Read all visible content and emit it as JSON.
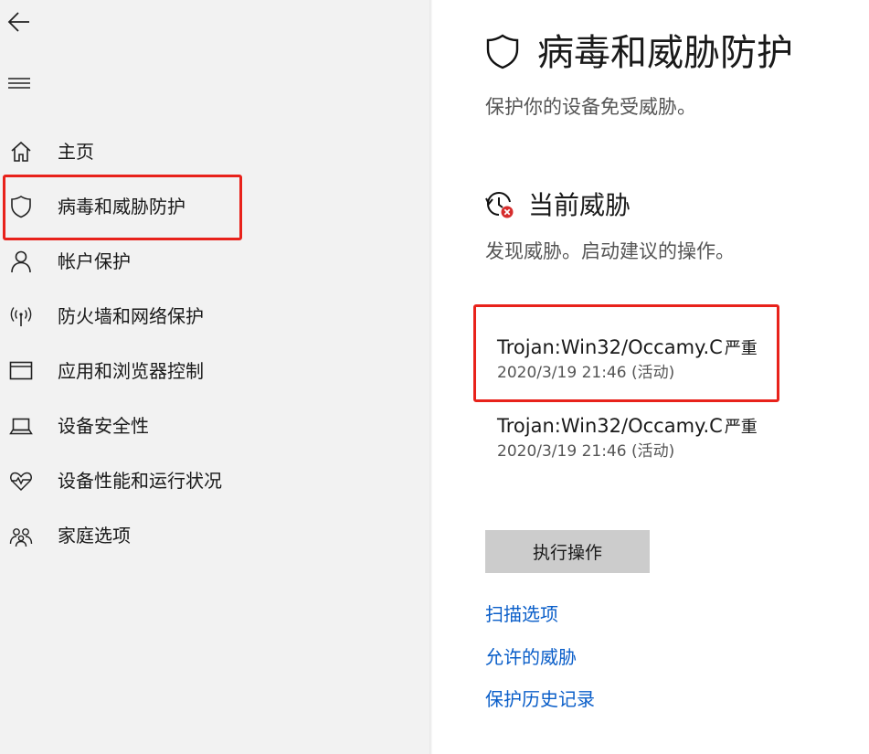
{
  "sidebar": {
    "back_icon": "back-arrow-icon",
    "menu_icon": "hamburger-menu-icon",
    "items": [
      {
        "label": "主页",
        "icon": "home-icon"
      },
      {
        "label": "病毒和威胁防护",
        "icon": "shield-icon",
        "selected": true
      },
      {
        "label": "帐户保护",
        "icon": "person-icon"
      },
      {
        "label": "防火墙和网络保护",
        "icon": "antenna-icon"
      },
      {
        "label": "应用和浏览器控制",
        "icon": "browser-window-icon"
      },
      {
        "label": "设备安全性",
        "icon": "laptop-icon"
      },
      {
        "label": "设备性能和运行状况",
        "icon": "heart-pulse-icon"
      },
      {
        "label": "家庭选项",
        "icon": "family-icon"
      }
    ]
  },
  "main": {
    "title": "病毒和威胁防护",
    "title_icon": "shield-icon",
    "subtitle": "保护你的设备免受威胁。",
    "section": {
      "title": "当前威胁",
      "icon": "threat-history-icon",
      "description": "发现威胁。启动建议的操作。"
    },
    "threats": [
      {
        "name": "Trojan:Win32/Occamy.C",
        "severity": "严重",
        "datetime": "2020/3/19 21:46",
        "status": "(活动)"
      },
      {
        "name": "Trojan:Win32/Occamy.C",
        "severity": "严重",
        "datetime": "2020/3/19 21:46",
        "status": "(活动)"
      }
    ],
    "action_button": "执行操作",
    "links": [
      "扫描选项",
      "允许的威胁",
      "保护历史记录"
    ]
  },
  "colors": {
    "sidebar_bg": "#f2f2f2",
    "highlight_red": "#e8221b",
    "link_blue": "#0a5ec9",
    "button_gray": "#cccccc",
    "alert_red": "#d62c2c"
  }
}
